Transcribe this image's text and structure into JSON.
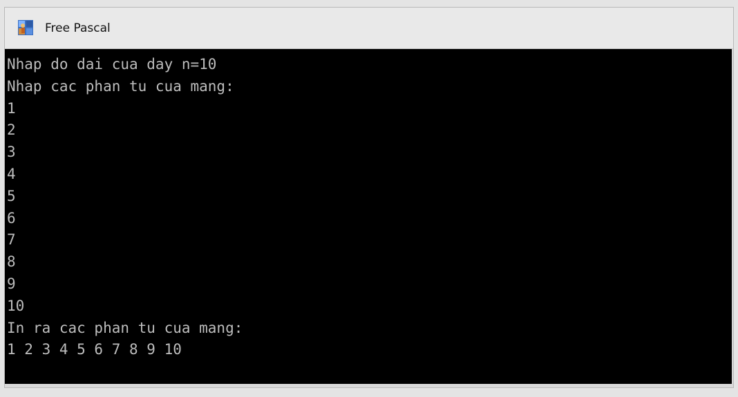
{
  "window": {
    "title": "Free Pascal",
    "icon": "free-pascal-app-icon"
  },
  "console": {
    "lines": [
      "Nhap do dai cua day n=10",
      "Nhap cac phan tu cua mang:",
      "1",
      "2",
      "3",
      "4",
      "5",
      "6",
      "7",
      "8",
      "9",
      "10",
      "In ra cac phan tu cua mang:",
      "1 2 3 4 5 6 7 8 9 10"
    ]
  },
  "colors": {
    "console_bg": "#000000",
    "console_text": "#bdbdbd",
    "titlebar_bg": "#e9e9e9"
  }
}
